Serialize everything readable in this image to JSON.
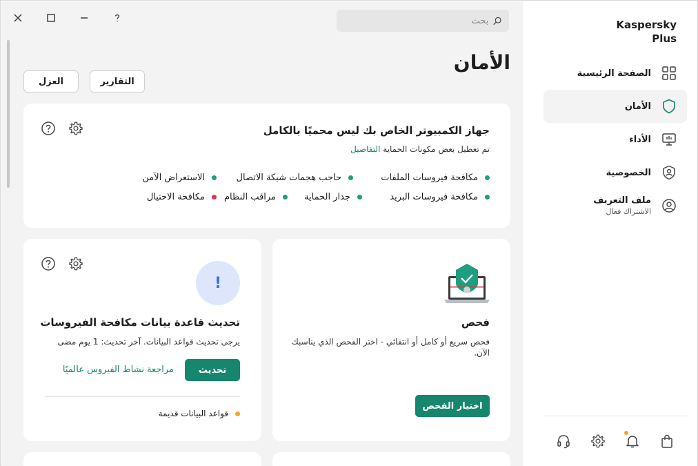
{
  "app": {
    "title_line1": "Kaspersky",
    "title_line2": "Plus"
  },
  "search": {
    "placeholder": "بحث"
  },
  "page": {
    "title": "الأمان"
  },
  "top_buttons": {
    "reports": "التقارير",
    "quarantine": "العزل"
  },
  "status_card": {
    "title": "جهاز الكمبيوتر الخاص بك ليس محميًا بالكامل",
    "subtitle": "تم تعطيل بعض مكونات الحماية",
    "details_link": "التفاصيل",
    "components": [
      {
        "label": "مكافحة فيروسات الملفات",
        "status": "on"
      },
      {
        "label": "حاجب هجمات شبكة الاتصال",
        "status": "on"
      },
      {
        "label": "الاستعراض الآمن",
        "status": "on"
      },
      {
        "label": "مكافحة فيروسات البريد",
        "status": "on"
      },
      {
        "label": "جدار الحماية",
        "status": "on"
      },
      {
        "label": "مراقب النظام",
        "status": "on"
      },
      {
        "label": "مكافحة الاحتيال",
        "status": "off"
      }
    ]
  },
  "scan_card": {
    "title": "فحص",
    "description": "فحص سريع أو كامل أو انتقائي - اختر الفحص الذي يناسبك الآن.",
    "button": "اختيار الفحص"
  },
  "update_card": {
    "badge": "!",
    "title": "تحديث قاعدة بيانات مكافحة الفيروسات",
    "description": "يرجى تحديث قواعد البيانات. آخر تحديث: 1 يوم مضى",
    "button": "تحديث",
    "link": "مراجعة نشاط الفيروس عالميًا",
    "status": "قواعد البيانات قديمة"
  },
  "sidebar": {
    "items": [
      {
        "label": "الصفحة الرئيسية",
        "icon": "dashboard-icon"
      },
      {
        "label": "الأمان",
        "icon": "shield-icon",
        "active": true
      },
      {
        "label": "الأداء",
        "icon": "performance-icon"
      },
      {
        "label": "الخصوصية",
        "icon": "privacy-icon"
      },
      {
        "label": "ملف التعريف",
        "sub": "الاشتراك فعال",
        "icon": "profile-icon"
      }
    ]
  },
  "colors": {
    "accent": "#17866f",
    "status_on": "#1f9d7f",
    "status_off": "#e5334b",
    "warning": "#f5a623",
    "badge_bg": "#dde6fb",
    "badge_fg": "#3f6fd8"
  }
}
